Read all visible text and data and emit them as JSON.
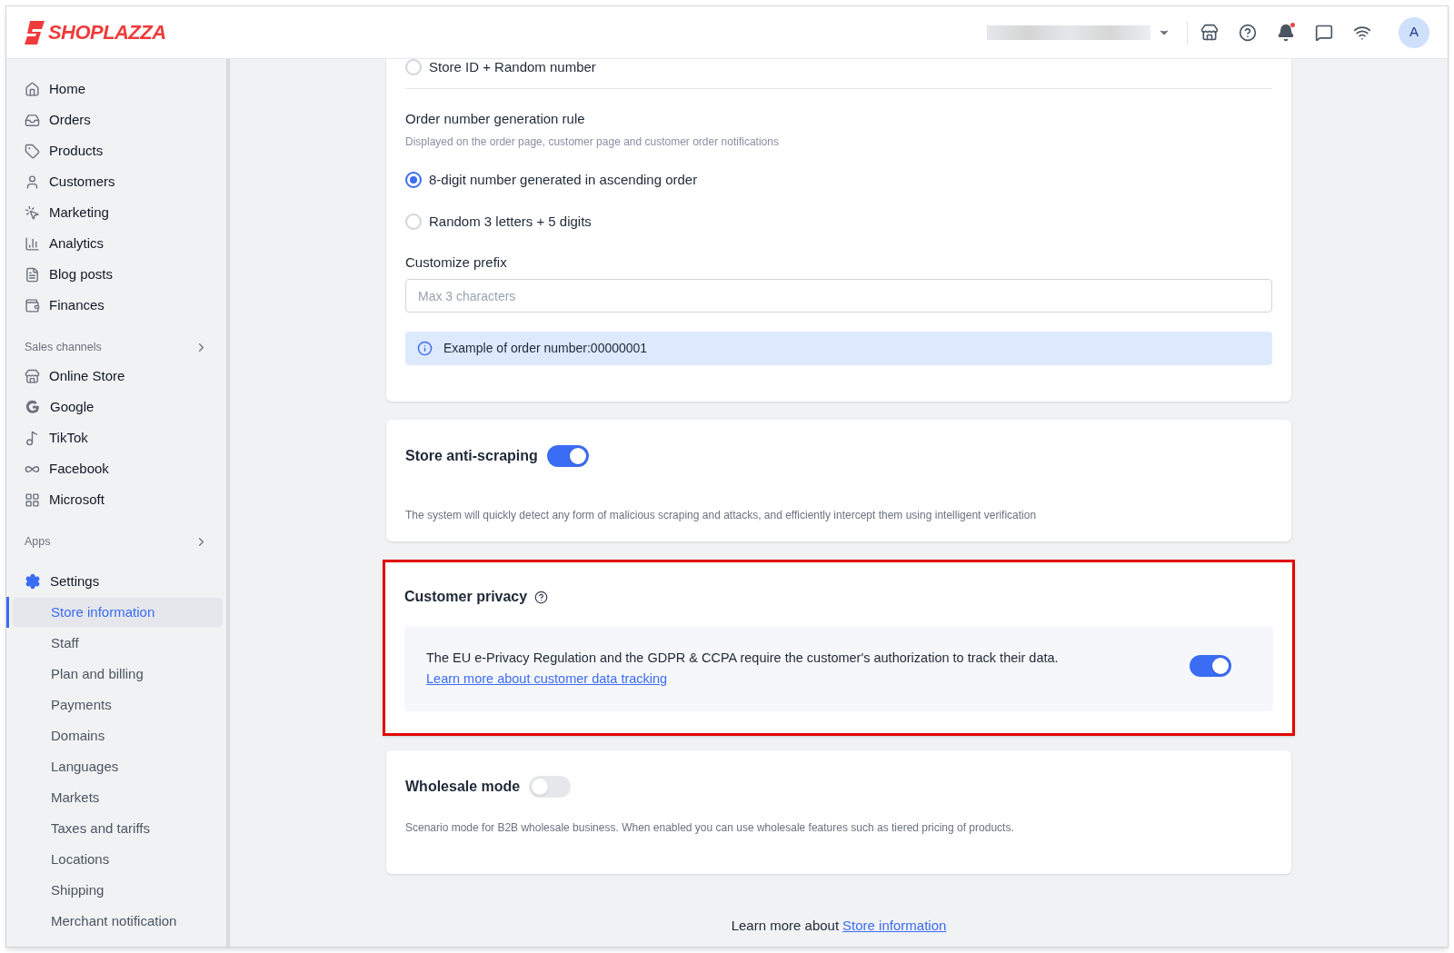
{
  "header": {
    "logo": "SHOPLAZZA",
    "has_unread": true,
    "avatar": "A"
  },
  "sidebar": {
    "main_items": [
      {
        "label": "Home"
      },
      {
        "label": "Orders"
      },
      {
        "label": "Products"
      },
      {
        "label": "Customers"
      },
      {
        "label": "Marketing"
      },
      {
        "label": "Analytics"
      },
      {
        "label": "Blog posts"
      },
      {
        "label": "Finances"
      }
    ],
    "sales_channels": {
      "heading": "Sales channels",
      "items": [
        {
          "label": "Online Store"
        },
        {
          "label": "Google"
        },
        {
          "label": "TikTok"
        },
        {
          "label": "Facebook"
        },
        {
          "label": "Microsoft"
        }
      ]
    },
    "apps": {
      "heading": "Apps"
    },
    "settings": {
      "label": "Settings",
      "items": [
        {
          "label": "Store information",
          "selected": true
        },
        {
          "label": "Staff",
          "selected": false
        },
        {
          "label": "Plan and billing",
          "selected": false
        },
        {
          "label": "Payments",
          "selected": false
        },
        {
          "label": "Domains",
          "selected": false
        },
        {
          "label": "Languages",
          "selected": false
        },
        {
          "label": "Markets",
          "selected": false
        },
        {
          "label": "Taxes and tariffs",
          "selected": false
        },
        {
          "label": "Locations",
          "selected": false
        },
        {
          "label": "Shipping",
          "selected": false
        },
        {
          "label": "Merchant notification",
          "selected": false
        }
      ]
    }
  },
  "order_number": {
    "top_option": {
      "label": "Store ID + Random number",
      "selected": false
    },
    "title": "Order number generation rule",
    "hint": "Displayed on the order page, customer page and customer order notifications",
    "options": [
      {
        "label": "8-digit number generated in ascending order",
        "selected": true
      },
      {
        "label": "Random 3 letters + 5 digits",
        "selected": false
      }
    ],
    "prefix_label": "Customize prefix",
    "prefix_placeholder": "Max 3 characters",
    "example": "Example of order number:00000001"
  },
  "anti_scraping": {
    "title": "Store anti-scraping",
    "on": true,
    "description": "The system will quickly detect any form of malicious scraping and attacks, and efficiently intercept them using intelligent verification"
  },
  "customer_privacy": {
    "title": "Customer privacy",
    "highlighted": true,
    "text": "The EU e-Privacy Regulation and the GDPR & CCPA require the customer's authorization to track their data.",
    "link": "Learn more about customer data tracking",
    "on": true
  },
  "wholesale": {
    "title": "Wholesale mode",
    "on": false,
    "description": "Scenario mode for B2B wholesale business. When enabled you can use wholesale features such as tiered pricing of products."
  },
  "footer": {
    "text": "Learn more about",
    "link": "Store information"
  }
}
